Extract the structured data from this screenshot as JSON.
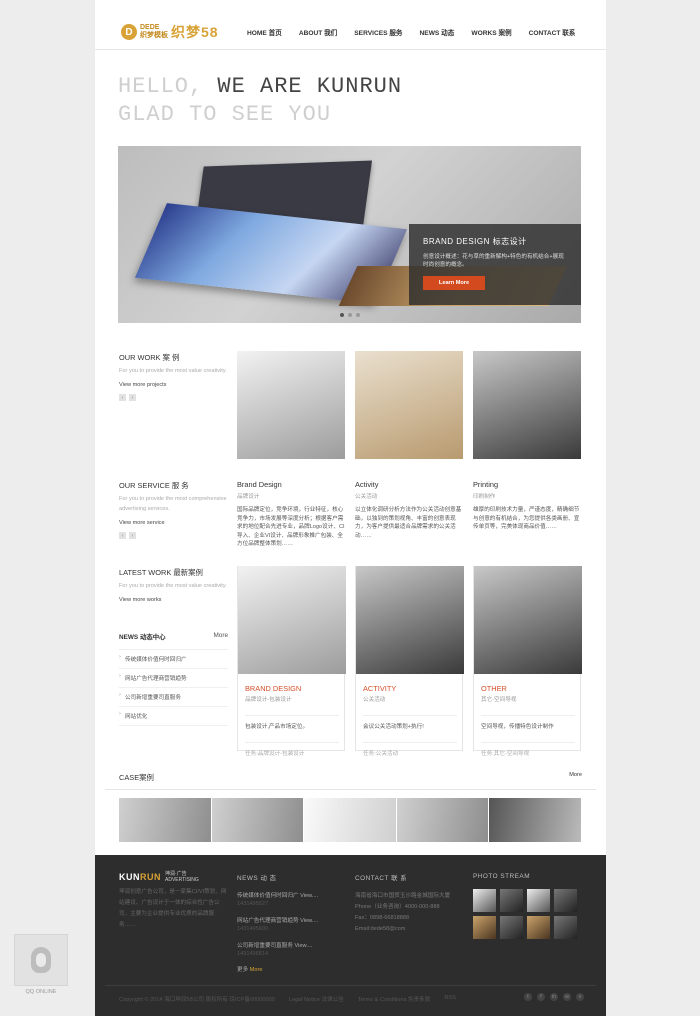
{
  "header": {
    "logo_mark": "D",
    "logo_sub1": "DEDE",
    "logo_sub2": "织梦模板",
    "logo_name": "织梦58",
    "nav": [
      "HOME 首页",
      "ABOUT 我们",
      "SERVICES 服务",
      "NEWS 动态",
      "WORKS 案例",
      "CONTACT 联系"
    ]
  },
  "hero": {
    "line1_a": "HELLO, ",
    "line1_b": "WE ARE KUNRUN",
    "line2": "GLAD TO SEE YOU"
  },
  "slider": {
    "title": "BRAND DESIGN 标志设计",
    "desc": "创意设计概述：花与草的重新解构+特色的有机结合+展现时尚创意的概念。",
    "button": "Learn More"
  },
  "our_work": {
    "heading": "OUR WORK 案 例",
    "desc": "For you to provide the most value creativity.",
    "link": "View more projects",
    "prev": "‹",
    "next": "›"
  },
  "our_service": {
    "heading": "OUR SERVICE 服 务",
    "desc": "For you to provide the most comprehensive advertising services.",
    "link": "View more service",
    "prev": "‹",
    "next": "›",
    "items": [
      {
        "title": "Brand Design",
        "sub": "品牌设计",
        "desc": "国际品牌定位，竞争环境，行业特征，核心竞争力，市场发展等深度分析；根据客户需求的地位配合先进专业，品牌Logo设计、CI 导入、企业VI设计、品牌形象推广包装、全方位品牌整体策划……"
      },
      {
        "title": "Activity",
        "sub": "公关活动",
        "desc": "以立体化调研分析方法作为公关活动创意基础，以独到的策划视角、丰富的创意表现力，为客户提供最适合品牌需求的公关活动……"
      },
      {
        "title": "Printing",
        "sub": "印刷制作",
        "desc": "雄厚的印刷技术力量，严谨态度，精确细节与创意的有机结合，为您提供各类画册、宣传单页等，完美体现商品价值……"
      }
    ]
  },
  "latest_work": {
    "heading": "LATEST WORK 最新案例",
    "desc": "For you to provide the most value creativity.",
    "link": "View more works",
    "cards": [
      {
        "title": "BRAND DESIGN",
        "sub": "品牌设计-包装设计",
        "desc": "包装设计,产品市场定位。",
        "footer": "任务:品牌设计-包装设计"
      },
      {
        "title": "ACTIVITY",
        "sub": "公关活动",
        "desc": "会议公关活动策划+执行!",
        "footer": "任务:公关活动"
      },
      {
        "title": "OTHER",
        "sub": "其它-空间导视",
        "desc": "空间导视，传播特色设计制作",
        "footer": "任务:其它-空间导视"
      }
    ]
  },
  "news": {
    "heading": "NEWS 动态中心",
    "more": "More",
    "items": [
      "传统媒体价值何时回归广",
      "网站广告代理商营销趋势",
      "公司新增重要司直服务",
      "网站优化"
    ]
  },
  "cases": {
    "heading": "CASE案例",
    "more": "More"
  },
  "footer": {
    "logo_a": "KUN",
    "logo_b": "RUN",
    "logo_cn": "坤润·广告",
    "logo_en": "ADVERTISING",
    "about": "坤润创意广告公司，是一家集CI/VI策划、网站建设、广告设计于一体的综合性广告公司，主要为企业提供专业优质的品牌服务……",
    "news_heading": "NEWS 动 态",
    "news_items": [
      {
        "title": "传统媒体价值何时回归广 View....",
        "date": "1431495527"
      },
      {
        "title": "网站广告代理商营销趋势 View....",
        "date": "1431495600"
      },
      {
        "title": "公司新增重要司直服务 View....",
        "date": "1431496814"
      }
    ],
    "news_more_a": "更多",
    "news_more_b": "More",
    "contact_heading": "CONTACT 联 系",
    "contact_lines": [
      "海南省海口市国贸玉沙路金城国际大厦",
      "Phone（业务咨询）4000-000-888",
      "Fax：0898-66818888",
      "Email:dede58@com"
    ],
    "photo_heading": "PHOTO STREAM",
    "bottom": [
      "Copyright © 2014 海口坤润58公司 版权所有 琼ICP备00000000",
      "Legal Notice 法律公告",
      "Terms & Conditions 免责条款",
      "RSS"
    ],
    "social": [
      "t",
      "f",
      "in",
      "w",
      "v"
    ]
  },
  "qq": {
    "label": "QQ ONLINE"
  }
}
